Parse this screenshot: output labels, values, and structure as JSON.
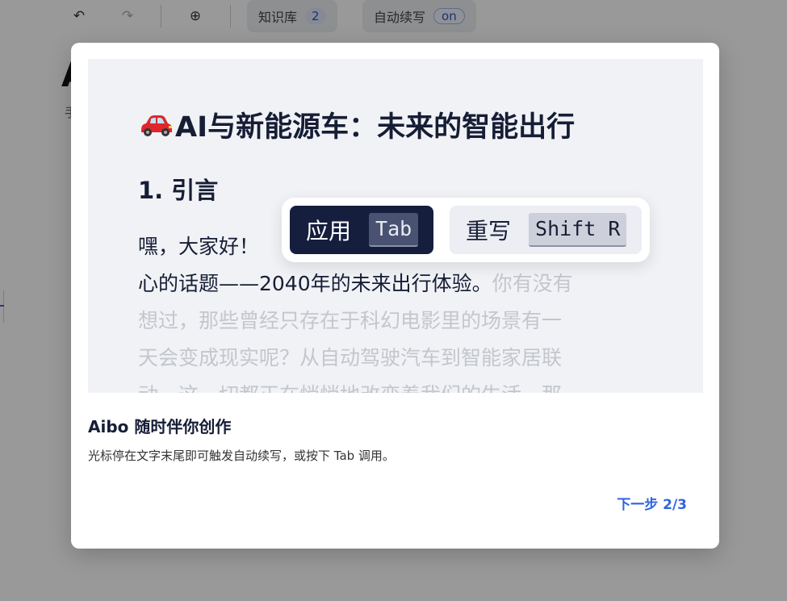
{
  "toolbar": {
    "undo_icon": "undo-icon",
    "redo_icon": "redo-icon",
    "add_icon": "add-circle-icon",
    "knowledge_label": "知识库",
    "knowledge_count": "2",
    "autocontinue_label": "自动续写",
    "autocontinue_state": "on"
  },
  "background_doc": {
    "title_peek": "A",
    "subtitle_peek": "手"
  },
  "modal": {
    "preview": {
      "title_icon": "car-icon",
      "title": "AI与新能源车：未来的智能出行",
      "heading": "1. 引言",
      "line1": "嘿，大家好！",
      "line2_main": "心的话题——2040年的未来出行体验。",
      "line2_faded": "你有没有",
      "line3": "想过，那些曾经只存在于科幻电影里的场景有一",
      "line4": "天会变成现实呢？从自动驾驶汽车到智能家居联",
      "line5": "动，这一切都正在悄悄地改变着我们的生活。那"
    },
    "popup": {
      "apply_label": "应用",
      "apply_key": "Tab",
      "rewrite_label": "重写",
      "rewrite_key": "Shift R"
    },
    "title": "Aibo 随时伴你创作",
    "description": "光标停在文字末尾即可触发自动续写，或按下 Tab 调用。",
    "next_label": "下一步 2/3"
  },
  "colors": {
    "accent": "#2f64e0",
    "dark_navy": "#161e3e",
    "preview_bg": "#f1f2f5"
  }
}
